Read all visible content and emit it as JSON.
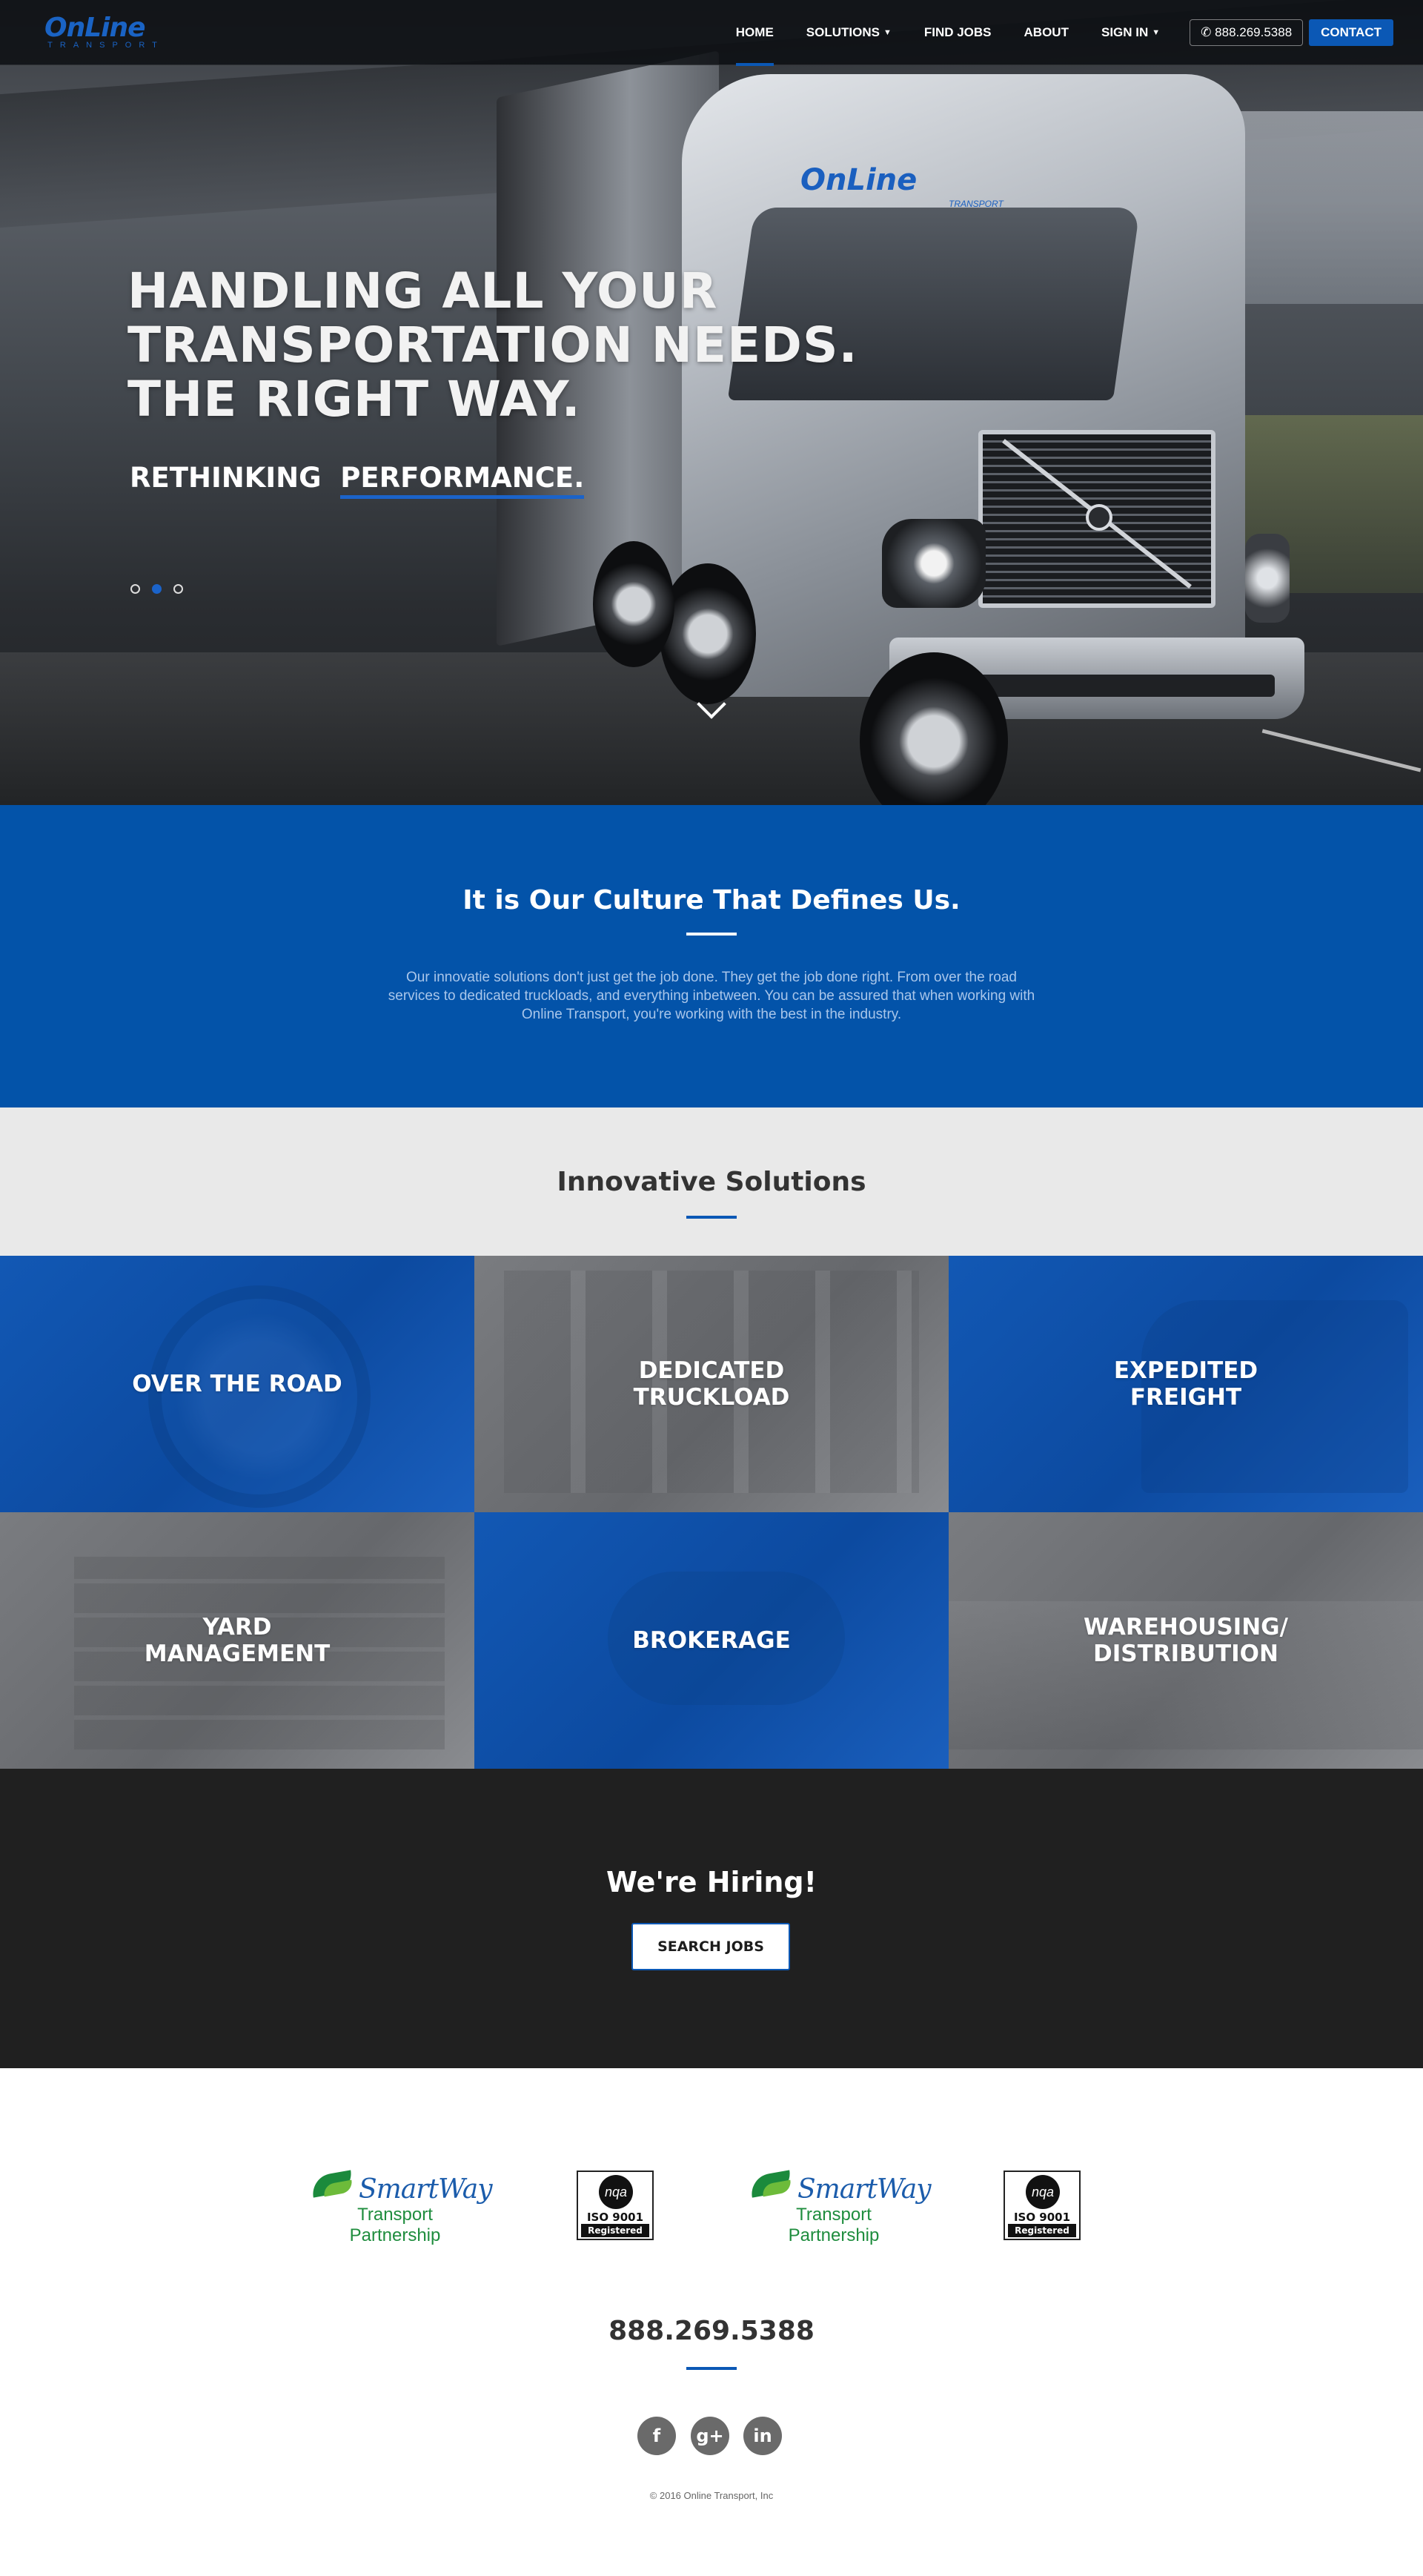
{
  "nav": {
    "logo_main": "OnLine",
    "logo_sub": "TRANSPORT",
    "links": [
      {
        "label": "HOME",
        "active": true
      },
      {
        "label": "SOLUTIONS",
        "has_caret": true
      },
      {
        "label": "FIND JOBS"
      },
      {
        "label": "ABOUT"
      },
      {
        "label": "SIGN IN",
        "has_caret": true
      }
    ],
    "phone": "888.269.5388",
    "contact_label": "CONTACT"
  },
  "hero": {
    "title_line1": "HANDLING ALL YOUR",
    "title_line2": "TRANSPORTATION NEEDS.",
    "title_line3": "THE RIGHT WAY.",
    "subtitle_prefix": "RETHINKING",
    "subtitle_highlight": "PERFORMANCE.",
    "slides_total": 3,
    "active_slide": 2,
    "truck_logo": "OnLine",
    "truck_logo_sub": "TRANSPORT"
  },
  "culture": {
    "heading": "It is Our Culture That Defines Us.",
    "body": "Our innovatie solutions don't just get the job done. They get the job done right. From over the road services to dedicated truckloads, and everything inbetween. You can be assured that when working with Online Transport, you're working with the best in the industry."
  },
  "solutions": {
    "heading": "Innovative Solutions",
    "tiles": [
      {
        "label": "OVER THE ROAD"
      },
      {
        "label": "DEDICATED\nTRUCKLOAD"
      },
      {
        "label": "EXPEDITED\nFREIGHT"
      },
      {
        "label": "YARD\nMANAGEMENT"
      },
      {
        "label": "BROKERAGE"
      },
      {
        "label": "WAREHOUSING/\nDISTRIBUTION"
      }
    ]
  },
  "hiring": {
    "heading": "We're Hiring!",
    "button_label": "SEARCH JOBS"
  },
  "footer": {
    "certs": [
      {
        "type": "smartway",
        "name": "SmartWay",
        "tagline": "Transport Partnership"
      },
      {
        "type": "iso",
        "badge": "nqa",
        "number": "ISO 9001",
        "status": "Registered"
      },
      {
        "type": "smartway",
        "name": "SmartWay",
        "tagline": "Transport Partnership"
      },
      {
        "type": "iso",
        "badge": "nqa",
        "number": "ISO 9001",
        "status": "Registered"
      }
    ],
    "phone": "888.269.5388",
    "social": [
      {
        "icon": "facebook-icon",
        "glyph": "f"
      },
      {
        "icon": "google-plus-icon",
        "glyph": "g+"
      },
      {
        "icon": "linkedin-icon",
        "glyph": "in"
      }
    ],
    "copyright": "© 2016 Online Transport, Inc"
  },
  "colors": {
    "brand_blue": "#0353a9",
    "accent_blue": "#0b58b5",
    "dark_band": "#202020",
    "light_band": "#e9e9e9"
  }
}
